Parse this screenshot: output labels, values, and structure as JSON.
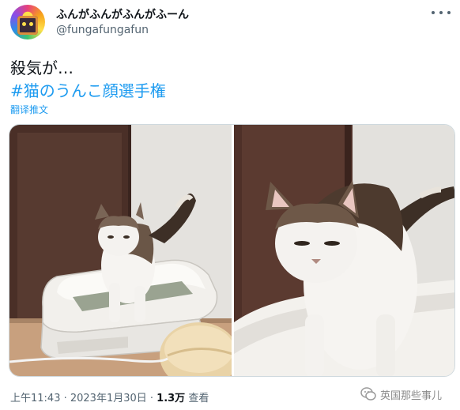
{
  "tweet": {
    "display_name": "ふんがふんがふんがふーん",
    "handle": "@fungafungafun",
    "text_line1": "殺気が…",
    "hashtag": "#猫のうんこ顔選手権",
    "translate": "翻译推文",
    "time_date": "上午11:43 · 2023年1月30日 · ",
    "views_count": "1.3万",
    "views_label": " 查看"
  },
  "watermark": {
    "text": "英国那些事儿"
  },
  "icons": {
    "avatar": "avatar-illustration",
    "more": "more-dots-icon",
    "watermark": "wechat-icon"
  },
  "colors": {
    "link": "#1d9bf0",
    "text": "#0f1419",
    "secondary": "#536471",
    "border": "#cfd9de"
  }
}
